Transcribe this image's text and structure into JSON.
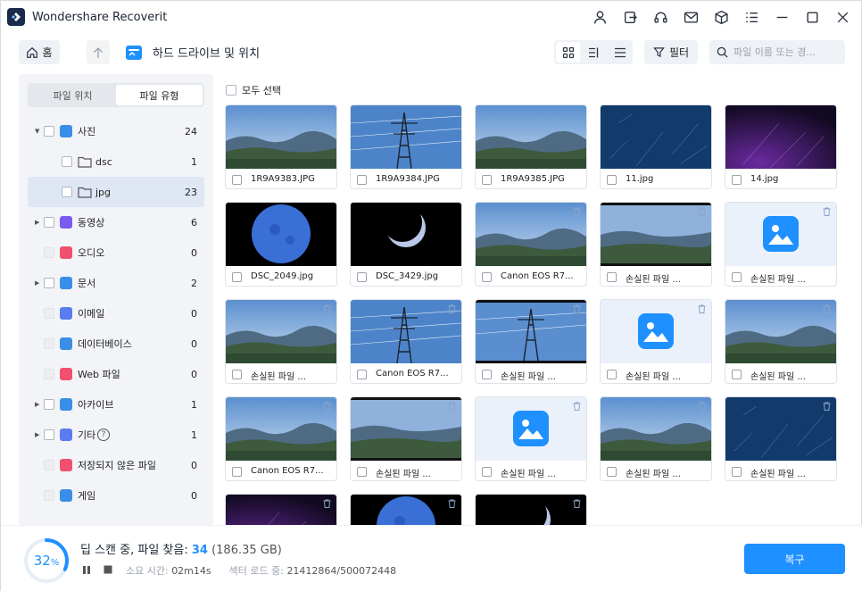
{
  "app": {
    "title": "Wondershare Recoverit"
  },
  "titlebar_icons": [
    "user-icon",
    "sign-out-icon",
    "headset-icon",
    "mail-icon",
    "box-icon",
    "menu-list-icon",
    "minimize-icon",
    "maximize-icon",
    "close-icon"
  ],
  "toolbar": {
    "home_label": "홈",
    "location_label": "하드 드라이브 및 위치",
    "filter_label": "필터",
    "search_placeholder": "파일 이름 또는 경..."
  },
  "sidebar": {
    "tabs": [
      {
        "label": "파일 위치",
        "active": false
      },
      {
        "label": "파일 유형",
        "active": true
      }
    ],
    "items": [
      {
        "label": "사진",
        "count": "24",
        "icon": "photo-icon",
        "color": "#3b8ee8",
        "expand": "down",
        "checkbox": true,
        "indent": 0
      },
      {
        "label": "dsc",
        "count": "1",
        "icon": "folder-icon",
        "color": "#555555",
        "expand": "",
        "checkbox": true,
        "indent": 1
      },
      {
        "label": "jpg",
        "count": "23",
        "icon": "folder-icon",
        "color": "#555555",
        "expand": "",
        "checkbox": true,
        "indent": 1,
        "selected": true
      },
      {
        "label": "동영상",
        "count": "6",
        "icon": "video-icon",
        "color": "#7b5cf0",
        "expand": "right",
        "checkbox": true,
        "indent": 0
      },
      {
        "label": "오디오",
        "count": "0",
        "icon": "audio-icon",
        "color": "#f0506e",
        "expand": "",
        "checkbox": false,
        "indent": 0
      },
      {
        "label": "문서",
        "count": "2",
        "icon": "document-icon",
        "color": "#3b8ee8",
        "expand": "right",
        "checkbox": true,
        "indent": 0
      },
      {
        "label": "이메일",
        "count": "0",
        "icon": "email-icon",
        "color": "#5b7cf0",
        "expand": "",
        "checkbox": false,
        "indent": 0
      },
      {
        "label": "데이터베이스",
        "count": "0",
        "icon": "database-icon",
        "color": "#3b8ee8",
        "expand": "",
        "checkbox": false,
        "indent": 0
      },
      {
        "label": "Web 파일",
        "count": "0",
        "icon": "web-icon",
        "color": "#f0506e",
        "expand": "",
        "checkbox": false,
        "indent": 0
      },
      {
        "label": "아카이브",
        "count": "1",
        "icon": "archive-icon",
        "color": "#3b8ee8",
        "expand": "right",
        "checkbox": true,
        "indent": 0
      },
      {
        "label": "기타",
        "count": "1",
        "icon": "other-icon",
        "color": "#5b7cf0",
        "expand": "right",
        "checkbox": true,
        "indent": 0,
        "help": true
      },
      {
        "label": "저장되지 않은 파일",
        "count": "0",
        "icon": "unsaved-icon",
        "color": "#f0506e",
        "expand": "",
        "checkbox": false,
        "indent": 0
      },
      {
        "label": "게임",
        "count": "0",
        "icon": "game-icon",
        "color": "#3b8ee8",
        "expand": "",
        "checkbox": false,
        "indent": 0
      }
    ]
  },
  "content": {
    "select_all_label": "모두 선택",
    "files": [
      {
        "name": "1R9A9383.JPG",
        "thumb": "mountain",
        "trash": false
      },
      {
        "name": "1R9A9384.JPG",
        "thumb": "pylon",
        "trash": false
      },
      {
        "name": "1R9A9385.JPG",
        "thumb": "mountain",
        "trash": false
      },
      {
        "name": "11.jpg",
        "thumb": "stars-blue",
        "trash": false
      },
      {
        "name": "14.jpg",
        "thumb": "stars-purple",
        "trash": false
      },
      {
        "name": "DSC_2049.jpg",
        "thumb": "moon",
        "trash": false
      },
      {
        "name": "DSC_3429.jpg",
        "thumb": "crescent",
        "trash": false
      },
      {
        "name": "Canon EOS R7...",
        "thumb": "mountain",
        "trash": true
      },
      {
        "name": "손실된 파일 ...",
        "thumb": "mountain-letterbox",
        "trash": true
      },
      {
        "name": "손실된 파일 ...",
        "thumb": "placeholder",
        "trash": true
      },
      {
        "name": "손실된 파일 ...",
        "thumb": "mountain",
        "trash": true
      },
      {
        "name": "Canon EOS R7...",
        "thumb": "pylon",
        "trash": true
      },
      {
        "name": "손실된 파일 ...",
        "thumb": "pylon-letterbox",
        "trash": true
      },
      {
        "name": "손실된 파일 ...",
        "thumb": "placeholder",
        "trash": true
      },
      {
        "name": "손실된 파일 ...",
        "thumb": "mountain",
        "trash": true
      },
      {
        "name": "Canon EOS R7...",
        "thumb": "mountain",
        "trash": true
      },
      {
        "name": "손실된 파일 ...",
        "thumb": "mountain-letterbox",
        "trash": true
      },
      {
        "name": "손실된 파일 ...",
        "thumb": "placeholder",
        "trash": true
      },
      {
        "name": "손실된 파일 ...",
        "thumb": "mountain",
        "trash": true
      },
      {
        "name": "손실된 파일 ...",
        "thumb": "stars-blue",
        "trash": true
      },
      {
        "name": "",
        "thumb": "stars-purple",
        "trash": true
      },
      {
        "name": "",
        "thumb": "moon",
        "trash": true
      },
      {
        "name": "",
        "thumb": "crescent",
        "trash": true
      }
    ]
  },
  "status": {
    "progress_value": "32",
    "progress_unit": "%",
    "progress_fraction": 0.32,
    "title_prefix": "딥 스캔 중, 파일 찾음: ",
    "found_count": "34",
    "found_size": " (186.35 GB)",
    "elapsed_label": "소요 시간: ",
    "elapsed_value": "02m14s",
    "sector_label": "섹터 로드 중: ",
    "sector_value": "21412864/500072448"
  },
  "actions": {
    "recover_label": "복구"
  },
  "colors": {
    "accent": "#1e90ff",
    "sidebar_bg": "#f2f4f7",
    "selected_row": "#dfe7f5"
  }
}
